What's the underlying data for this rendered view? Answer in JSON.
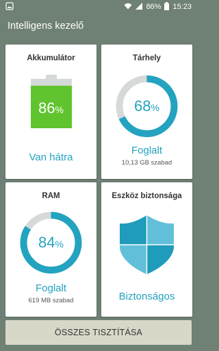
{
  "status_bar": {
    "battery_text": "86%",
    "time": "15:23"
  },
  "app": {
    "title": "Intelligens kezelő"
  },
  "battery_card": {
    "title": "Akkumulátor",
    "level_value": "86",
    "level_unit": "%",
    "level_fraction": 0.86,
    "status": "Van hátra",
    "fill_color": "#5fc42d"
  },
  "storage_card": {
    "title": "Tárhely",
    "percent_value": "68",
    "percent_unit": "%",
    "percent_fraction": 0.68,
    "status": "Foglalt",
    "free_text": "10,13 GB szabad"
  },
  "ram_card": {
    "title": "RAM",
    "percent_value": "84",
    "percent_unit": "%",
    "percent_fraction": 0.84,
    "status": "Foglalt",
    "free_text": "619 MB szabad"
  },
  "security_card": {
    "title": "Eszköz biztonsága",
    "status": "Biztonságos",
    "icon": "shield-icon"
  },
  "actions": {
    "clean_all_label": "ÖSSZES TISZTÍTÁSA"
  },
  "colors": {
    "accent": "#23a3bf",
    "ring_track": "#d6d9d9",
    "background": "#6f8074"
  }
}
